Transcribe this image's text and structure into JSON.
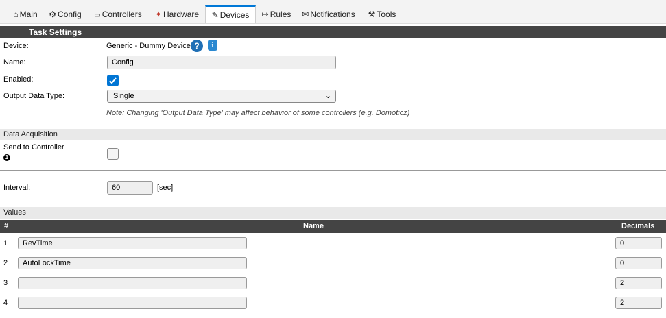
{
  "tabs": [
    {
      "label": "Main",
      "icon": "⌂"
    },
    {
      "label": "Config",
      "icon": "⚙"
    },
    {
      "label": "Controllers",
      "icon": "💬"
    },
    {
      "label": "Hardware",
      "icon": "📌"
    },
    {
      "label": "Devices",
      "icon": "✎"
    },
    {
      "label": "Rules",
      "icon": "↦"
    },
    {
      "label": "Notifications",
      "icon": "✉"
    },
    {
      "label": "Tools",
      "icon": "🔧"
    }
  ],
  "active_tab": "Devices",
  "task_settings": {
    "header": "Task Settings",
    "device_label": "Device:",
    "device_value": "Generic - Dummy Device",
    "help_glyph": "?",
    "info_glyph": "i",
    "name_label": "Name:",
    "name_value": "Config",
    "enabled_label": "Enabled:",
    "enabled": true,
    "output_label": "Output Data Type:",
    "output_value": "Single",
    "note": "Note: Changing 'Output Data Type' may affect behavior of some controllers (e.g. Domoticz)"
  },
  "data_acquisition": {
    "header": "Data Acquisition",
    "send_label": "Send to Controller",
    "send_marker": "1",
    "send_checked": false,
    "interval_label": "Interval:",
    "interval_value": "60",
    "interval_unit": "[sec]"
  },
  "values": {
    "header": "Values",
    "col_num": "#",
    "col_name": "Name",
    "col_decimals": "Decimals",
    "rows": [
      {
        "num": "1",
        "name": "RevTime",
        "decimals": "0"
      },
      {
        "num": "2",
        "name": "AutoLockTime",
        "decimals": "0"
      },
      {
        "num": "3",
        "name": "",
        "decimals": "2"
      },
      {
        "num": "4",
        "name": "",
        "decimals": "2"
      }
    ]
  },
  "colors": {
    "dark_header": "#444444",
    "light_header": "#e9e9e9",
    "accent": "#0075d4",
    "active_tab_border": "#0078d7"
  }
}
